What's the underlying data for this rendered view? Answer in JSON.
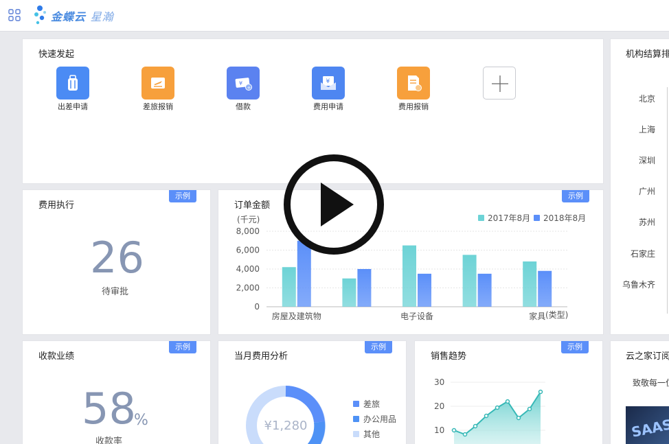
{
  "header": {
    "logo_text_a": "金蝶云",
    "logo_text_b": "星瀚"
  },
  "quick_actions": {
    "title": "快速发起",
    "items": [
      {
        "label": "出差申请",
        "icon": "luggage-icon",
        "color": "#4b8bf4"
      },
      {
        "label": "差旅报销",
        "icon": "plane-ticket-icon",
        "color": "#f7a03c"
      },
      {
        "label": "借款",
        "icon": "yen-bill-icon",
        "color": "#5b82f0"
      },
      {
        "label": "费用申请",
        "icon": "yen-envelope-icon",
        "color": "#4e86f1"
      },
      {
        "label": "费用报销",
        "icon": "receipt-icon",
        "color": "#f7a03c"
      }
    ]
  },
  "settlement": {
    "title": "机构结算排",
    "cities": [
      "北京",
      "上海",
      "深圳",
      "广州",
      "苏州",
      "石家庄",
      "乌鲁木齐"
    ]
  },
  "sample_label": "示例",
  "expense_exec": {
    "title": "费用执行",
    "value": "26",
    "caption": "待审批"
  },
  "order_amount": {
    "title": "订单金额",
    "unit": "(千元)",
    "x_axis_unit": "(类型)"
  },
  "chart_data": {
    "type": "bar",
    "title": "订单金额",
    "ylabel": "(千元)",
    "xlabel": "(类型)",
    "categories": [
      "房屋及建筑物",
      "",
      "电子设备",
      "",
      "家具"
    ],
    "ylim": [
      0,
      8000
    ],
    "yticks": [
      "8,000",
      "6,000",
      "4,000",
      "2,000",
      "0"
    ],
    "series": [
      {
        "name": "2017年8月",
        "color": "#6dd3d6",
        "values": [
          4200,
          3000,
          6500,
          5500,
          4800
        ]
      },
      {
        "name": "2018年8月",
        "color": "#5b8ff9",
        "values": [
          7000,
          4000,
          3500,
          3500,
          3800
        ]
      }
    ],
    "legend": "top-right"
  },
  "collections": {
    "title": "收款业绩",
    "value": "58",
    "suffix": "%",
    "caption": "收款率"
  },
  "monthly_expense": {
    "title": "当月费用分析",
    "center_value": "¥1,280",
    "legend": [
      {
        "label": "差旅",
        "color": "#5b8ff9"
      },
      {
        "label": "办公用品",
        "color": "#4e92f5"
      },
      {
        "label": "其他",
        "color": "#c9dcfb"
      }
    ]
  },
  "sales_trend": {
    "title": "销售趋势",
    "yticks": [
      "30",
      "20",
      "10"
    ]
  },
  "cloud_home": {
    "title": "云之家订阅",
    "subtitle": "致敬每一位"
  }
}
